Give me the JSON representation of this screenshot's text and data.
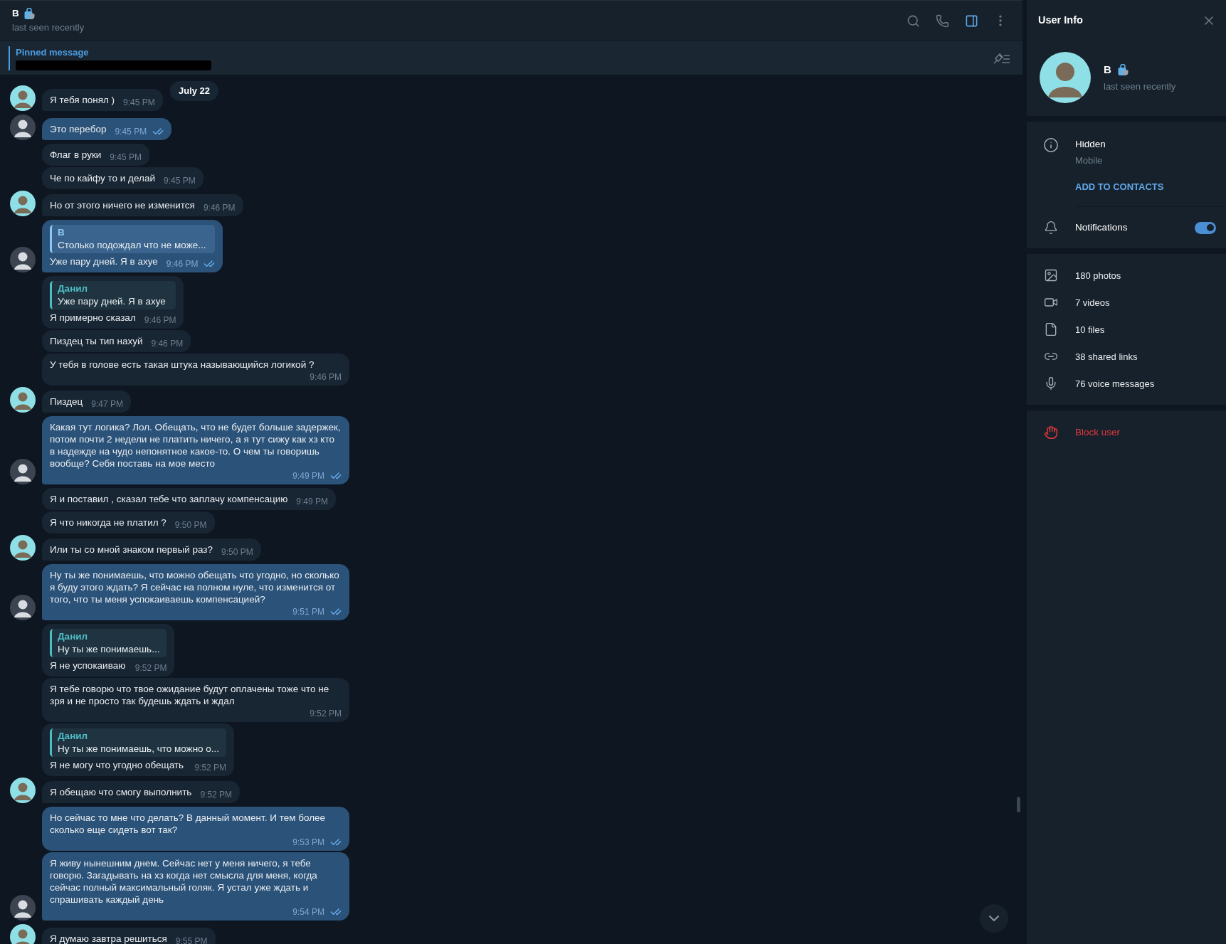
{
  "header": {
    "name": "В",
    "status": "last seen recently",
    "actions": [
      {
        "kind": "search",
        "selected": false
      },
      {
        "kind": "call",
        "selected": false
      },
      {
        "kind": "sidebar",
        "selected": true
      },
      {
        "kind": "more",
        "selected": false
      }
    ]
  },
  "pinned": {
    "label": "Pinned message"
  },
  "date_badge": "July 22",
  "messages": [
    {
      "kind": "in",
      "text": "Я тебя понял )",
      "time": "9:45 PM",
      "avatar": true
    },
    {
      "kind": "out",
      "text": "Это перебор",
      "time": "9:45 PM",
      "avatar": true,
      "read": true
    },
    {
      "kind": "in",
      "text": "Флаг в руки",
      "time": "9:45 PM",
      "avatar": false
    },
    {
      "kind": "in",
      "text": "Че по кайфу то и делай",
      "time": "9:45 PM",
      "avatar": false
    },
    {
      "kind": "in",
      "text": "Но от этого ничего не изменится",
      "time": "9:46 PM",
      "avatar": true
    },
    {
      "kind": "out",
      "reply": {
        "name": "В",
        "text": "Столько подождал что не може...",
        "color": "#8cc8f5"
      },
      "text": "Уже пару дней. Я в ахуе",
      "time": "9:46 PM",
      "avatar": true,
      "read": true
    },
    {
      "kind": "in",
      "reply": {
        "name": "Данил",
        "text": "Уже пару дней. Я в ахуе",
        "color": "#4fbdc4"
      },
      "text": "Я примерно сказал",
      "time": "9:46 PM",
      "avatar": false
    },
    {
      "kind": "in",
      "text": "Пиздец ты тип нахуй",
      "time": "9:46 PM",
      "avatar": false
    },
    {
      "kind": "in",
      "text": "У тебя в голове есть такая штука называющийся логикой ?",
      "time": "9:46 PM",
      "avatar": false
    },
    {
      "kind": "in",
      "text": "Пиздец",
      "time": "9:47 PM",
      "avatar": true
    },
    {
      "kind": "out",
      "text": "Какая тут логика? Лол. Обещать, что не будет больше задержек, потом почти 2 недели не платить ничего, а я тут сижу как хз кто в надежде на чудо непонятное какое-то. О чем ты говоришь вообще? Себя поставь на мое место",
      "time": "9:49 PM",
      "avatar": true,
      "read": true
    },
    {
      "kind": "in",
      "text": "Я и поставил , сказал тебе что заплачу компенсацию",
      "time": "9:49 PM",
      "avatar": false
    },
    {
      "kind": "in",
      "text": "Я что никогда не платил ?",
      "time": "9:50 PM",
      "avatar": false
    },
    {
      "kind": "in",
      "text": "Или ты со мной знаком первый раз?",
      "time": "9:50 PM",
      "avatar": true
    },
    {
      "kind": "out",
      "text": "Ну ты же понимаешь, что можно обещать что угодно, но сколько я буду этого ждать? Я сейчас на полном нуле, что изменится от того, что ты меня успокаиваешь компенсацией?",
      "time": "9:51 PM",
      "avatar": true,
      "read": true
    },
    {
      "kind": "in",
      "reply": {
        "name": "Данил",
        "text": "Ну ты же понимаешь...",
        "color": "#4fbdc4"
      },
      "text": "Я не успокаиваю",
      "time": "9:52 PM",
      "avatar": false
    },
    {
      "kind": "in",
      "text": "Я тебе говорю что твое ожидание будут оплачены тоже что не зря и не просто так будешь ждать и ждал",
      "time": "9:52 PM",
      "avatar": false
    },
    {
      "kind": "in",
      "reply": {
        "name": "Данил",
        "text": "Ну ты же понимаешь, что можно о...",
        "color": "#4fbdc4"
      },
      "text": "Я не могу что угодно обещать",
      "time": "9:52 PM",
      "avatar": false
    },
    {
      "kind": "in",
      "text": "Я обещаю что смогу выполнить",
      "time": "9:52 PM",
      "avatar": true
    },
    {
      "kind": "out",
      "text": "Но сейчас то мне что делать? В данный момент. И тем более сколько еще сидеть вот так?",
      "time": "9:53 PM",
      "avatar": false,
      "read": true
    },
    {
      "kind": "out",
      "text": "Я живу нынешним днем. Сейчас нет у меня ничего, я тебе говорю. Загадывать на хз когда нет смысла для меня, когда сейчас полный максимальный голяк. Я устал уже ждать и спрашивать каждый день",
      "time": "9:54 PM",
      "avatar": true,
      "read": true
    },
    {
      "kind": "in",
      "text": "Я думаю завтра решиться",
      "time": "9:55 PM",
      "avatar": true
    }
  ],
  "user_info": {
    "title": "User Info",
    "name": "В",
    "status": "last seen recently",
    "phone": "Hidden",
    "phone_label": "Mobile",
    "add_contact": "ADD TO CONTACTS",
    "notifications": {
      "label": "Notifications",
      "on": true
    },
    "media": [
      {
        "kind": "photos",
        "label": "180 photos"
      },
      {
        "kind": "videos",
        "label": "7 videos"
      },
      {
        "kind": "files",
        "label": "10 files"
      },
      {
        "kind": "links",
        "label": "38 shared links"
      },
      {
        "kind": "voice",
        "label": "76 voice messages"
      }
    ],
    "block": "Block user"
  }
}
